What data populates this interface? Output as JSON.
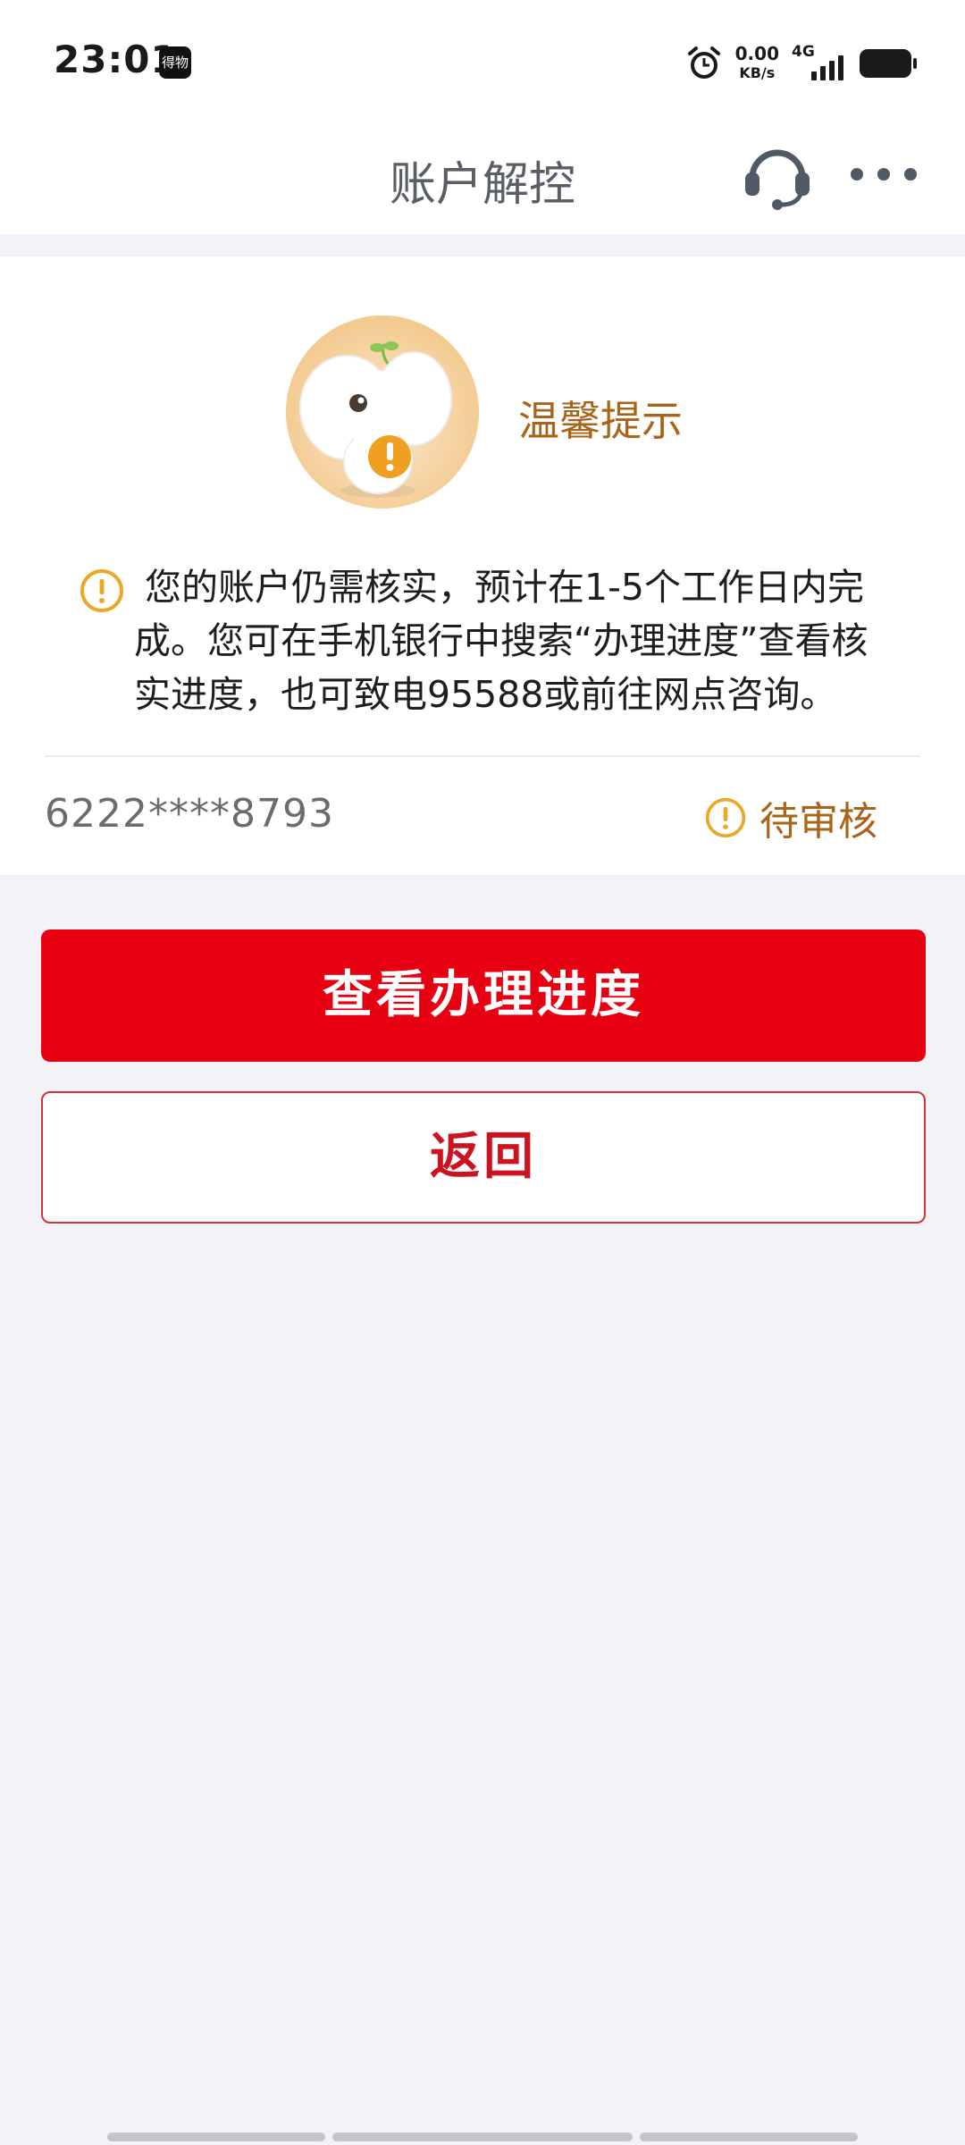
{
  "status_bar": {
    "time": "23:01",
    "app_icon_text": "得物",
    "net_speed_value": "0.00",
    "net_speed_unit": "KB/s",
    "network_type": "4G",
    "icons": [
      "alarm-icon",
      "signal-icon",
      "battery-icon"
    ]
  },
  "header": {
    "title": "账户解控",
    "icons": [
      "customer-service-icon",
      "more-icon"
    ]
  },
  "tip": {
    "title": "温馨提示",
    "message": "您的账户仍需核实，预计在1-5个工作日内完成。您可在手机银行中搜索“办理进度”查看核实进度，也可致电95588或前往网点咨询。"
  },
  "account": {
    "number": "6222****8793",
    "status": "待审核"
  },
  "buttons": {
    "primary_label": "查看办理进度",
    "secondary_label": "返回"
  },
  "colors": {
    "accent_red": "#e60012",
    "tip_brown": "#a8651a",
    "warning_orange": "#e9a825",
    "page_bg": "#f3f3f7"
  }
}
